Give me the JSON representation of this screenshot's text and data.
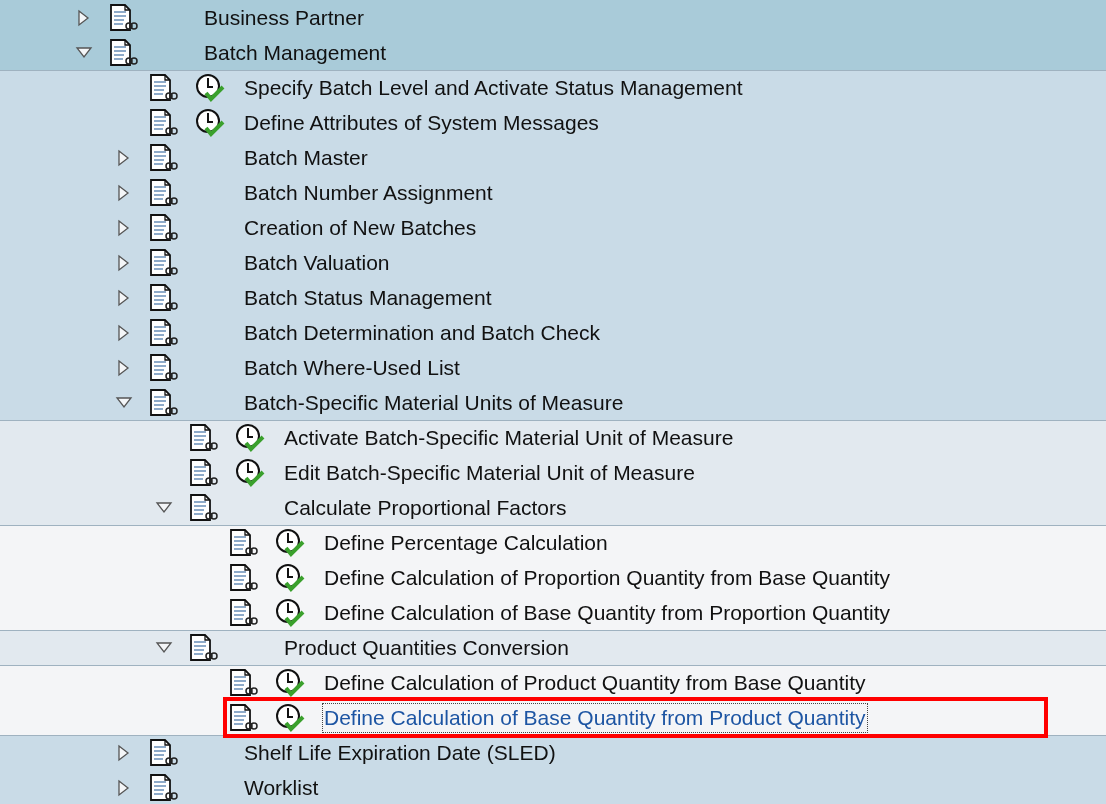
{
  "tree": [
    {
      "label": "Business Partner",
      "kind": "folder",
      "expanded": false,
      "selected": false
    },
    {
      "label": "Batch Management",
      "kind": "folder",
      "expanded": true,
      "selected": false,
      "children": [
        {
          "label": "Specify Batch Level and Activate Status Management",
          "kind": "activity",
          "selected": false
        },
        {
          "label": "Define Attributes of System Messages",
          "kind": "activity",
          "selected": false
        },
        {
          "label": "Batch Master",
          "kind": "folder",
          "expanded": false,
          "selected": false
        },
        {
          "label": "Batch Number Assignment",
          "kind": "folder",
          "expanded": false,
          "selected": false
        },
        {
          "label": "Creation of New Batches",
          "kind": "folder",
          "expanded": false,
          "selected": false
        },
        {
          "label": "Batch Valuation",
          "kind": "folder",
          "expanded": false,
          "selected": false
        },
        {
          "label": "Batch Status Management",
          "kind": "folder",
          "expanded": false,
          "selected": false
        },
        {
          "label": "Batch Determination and Batch Check",
          "kind": "folder",
          "expanded": false,
          "selected": false
        },
        {
          "label": "Batch Where-Used List",
          "kind": "folder",
          "expanded": false,
          "selected": false
        },
        {
          "label": "Batch-Specific Material Units of Measure",
          "kind": "folder",
          "expanded": true,
          "selected": false,
          "children": [
            {
              "label": "Activate Batch-Specific Material Unit of Measure",
              "kind": "activity",
              "selected": false
            },
            {
              "label": "Edit Batch-Specific Material Unit of Measure",
              "kind": "activity",
              "selected": false
            },
            {
              "label": "Calculate Proportional Factors",
              "kind": "folder",
              "expanded": true,
              "selected": false,
              "children": [
                {
                  "label": "Define Percentage Calculation",
                  "kind": "activity",
                  "selected": false
                },
                {
                  "label": "Define Calculation of Proportion Quantity from Base Quantity",
                  "kind": "activity",
                  "selected": false
                },
                {
                  "label": "Define Calculation of Base Quantity from Proportion Quantity",
                  "kind": "activity",
                  "selected": false
                }
              ]
            },
            {
              "label": "Product Quantities Conversion",
              "kind": "folder",
              "expanded": true,
              "selected": false,
              "children": [
                {
                  "label": "Define Calculation of Product Quantity from Base Quantity",
                  "kind": "activity",
                  "selected": false
                },
                {
                  "label": "Define Calculation of Base Quantity from Product Quantity",
                  "kind": "activity",
                  "selected": true
                }
              ]
            }
          ]
        },
        {
          "label": "Shelf Life Expiration Date (SLED)",
          "kind": "folder",
          "expanded": false,
          "selected": false
        },
        {
          "label": "Worklist",
          "kind": "folder",
          "expanded": false,
          "selected": false
        }
      ]
    }
  ],
  "highlight_box": true
}
